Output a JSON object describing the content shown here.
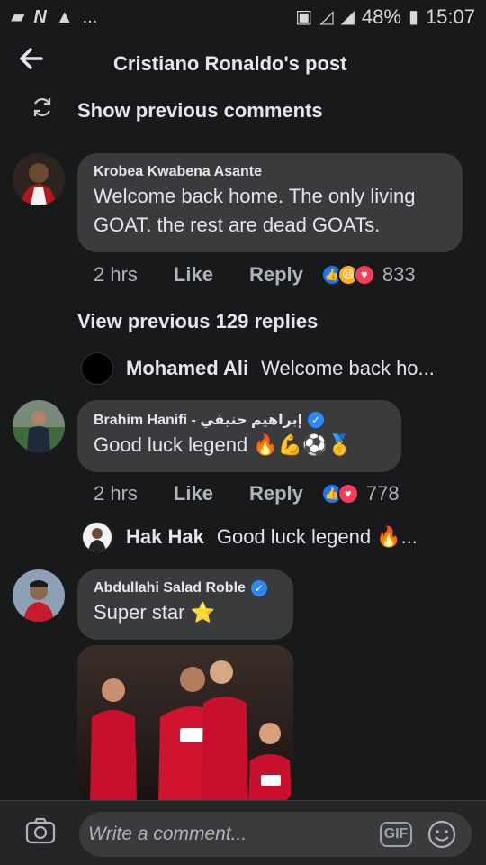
{
  "status_bar": {
    "left_icons": [
      "chat-icon",
      "network-icon",
      "warning-icon"
    ],
    "ellipsis": "...",
    "battery_percent": "48%",
    "time": "15:07"
  },
  "header": {
    "back_icon": "back-arrow-icon",
    "title": "Cristiano Ronaldo's post"
  },
  "show_previous": {
    "icon": "refresh-icon",
    "label": "Show previous comments"
  },
  "comments": [
    {
      "author": "Krobea Kwabena Asante",
      "text": "Welcome back home. The only living GOAT. the rest are dead GOATs.",
      "time": "2 hrs",
      "like_label": "Like",
      "reply_label": "Reply",
      "reactions": [
        "like",
        "haha",
        "love"
      ],
      "reaction_count": "833"
    },
    {
      "author": "Brahim Hanifi - إبراهيم حنيفي",
      "verified": true,
      "text": "Good luck legend 🔥💪⚽🥇",
      "time": "2 hrs",
      "like_label": "Like",
      "reply_label": "Reply",
      "reactions": [
        "like",
        "love"
      ],
      "reaction_count": "778"
    },
    {
      "author": "Abdullahi Salad Roble",
      "verified": true,
      "text": "Super star ⭐"
    }
  ],
  "view_previous_replies": "View previous 129 replies",
  "replies": [
    {
      "author": "Mohamed Ali",
      "preview": "Welcome back ho..."
    },
    {
      "author": "Hak Hak",
      "preview": "Good luck legend 🔥..."
    }
  ],
  "composer": {
    "placeholder": "Write a comment...",
    "camera_icon": "camera-icon",
    "gif_label": "GIF",
    "emoji_icon": "emoji-icon"
  }
}
